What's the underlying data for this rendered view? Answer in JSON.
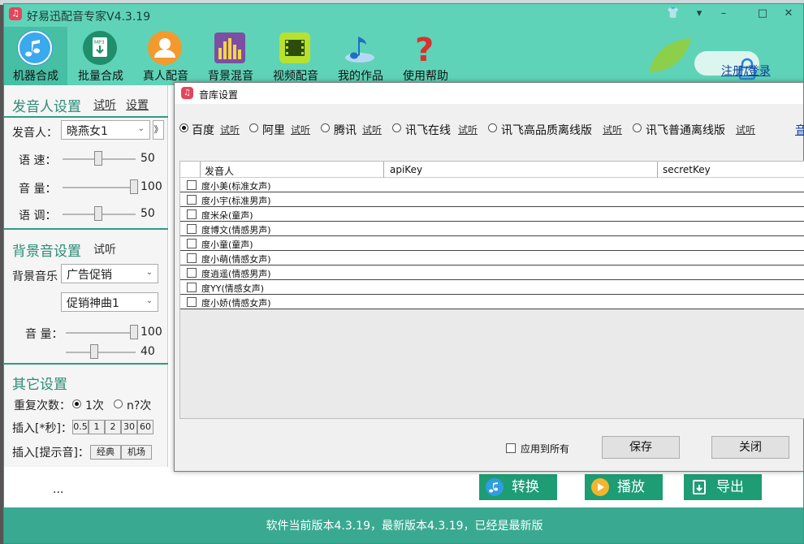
{
  "app": {
    "title": "好易迅配音专家V4.3.19",
    "logo_glyph": "♫",
    "window_controls": [
      "👕",
      "▾",
      "–",
      "□",
      "✕"
    ]
  },
  "toolbar": {
    "items": [
      {
        "label": "机器合成",
        "icon": "music-note-icon",
        "active": true
      },
      {
        "label": "批量合成",
        "icon": "mp3-download-icon"
      },
      {
        "label": "真人配音",
        "icon": "person-icon"
      },
      {
        "label": "背景混音",
        "icon": "equalizer-icon"
      },
      {
        "label": "视频配音",
        "icon": "film-icon"
      },
      {
        "label": "我的作品",
        "icon": "music-note-disc-icon"
      },
      {
        "label": "使用帮助",
        "icon": "question-mark-icon"
      }
    ],
    "register_login": "注册/登录"
  },
  "voice_settings": {
    "heading": "发音人设置",
    "try_link": "试听",
    "settings_link": "设置",
    "speaker_label": "发音人：",
    "speaker_value": "晓燕女1",
    "more_btn": "》",
    "speed_label": "语 速：",
    "speed_value": "50",
    "speed_level": 0.5,
    "volume_label": "音 量：",
    "volume_value": "100",
    "volume_level": 1.0,
    "pitch_label": "语 调：",
    "pitch_value": "50",
    "pitch_level": 0.5
  },
  "bg_settings": {
    "heading": "背景音设置",
    "try_link": "试听",
    "music_label": "背景音乐",
    "music_category": "广告促销",
    "music_track": "促销神曲1",
    "volume_label": "音 量：",
    "volume_value": "100",
    "volume_level": 1.0,
    "second_value": "40",
    "second_level": 0.4
  },
  "other_settings": {
    "heading": "其它设置",
    "repeat_label": "重复次数：",
    "repeat_opt1": "1次",
    "repeat_opt2": "n?次",
    "insert_sec_label": "插入[*秒]：",
    "insert_sec_opts": [
      "0.5",
      "1",
      "2",
      "30",
      "60"
    ],
    "insert_tone_label": "插入[提示音]：",
    "insert_tone_opts": [
      "经典",
      "机场"
    ],
    "dots": "..."
  },
  "actions": {
    "convert": "转换",
    "play": "播放",
    "export": "导出"
  },
  "footer": {
    "status": "软件当前版本4.3.19，最新版本4.3.19，已经是最新版"
  },
  "dialog": {
    "title": "音库设置",
    "engines": [
      {
        "name": "百度",
        "try": "试听",
        "selected": true
      },
      {
        "name": "阿里",
        "try": "试听"
      },
      {
        "name": "腾讯",
        "try": "试听"
      },
      {
        "name": "讯飞在线",
        "try": "试听"
      },
      {
        "name": "讯飞高品质离线版",
        "try": "试听"
      },
      {
        "name": "讯飞普通离线版",
        "try": "试听"
      }
    ],
    "more_link": "音",
    "columns": [
      "发音人",
      "apiKey",
      "secretKey"
    ],
    "rows": [
      "度小美(标准女声)",
      "度小宇(标准男声)",
      "度米朵(童声)",
      "度博文(情感男声)",
      "度小童(童声)",
      "度小萌(情感女声)",
      "度逍遥(情感男声)",
      "度YY(情感女声)",
      "度小娇(情感女声)"
    ],
    "apply_all": "应用到所有",
    "save": "保存",
    "close": "关闭"
  },
  "colors": {
    "brand": "#5fd3b8",
    "accent_text": "#2b8c75",
    "action_button": "#1e9c73",
    "footer": "#3aa991"
  }
}
